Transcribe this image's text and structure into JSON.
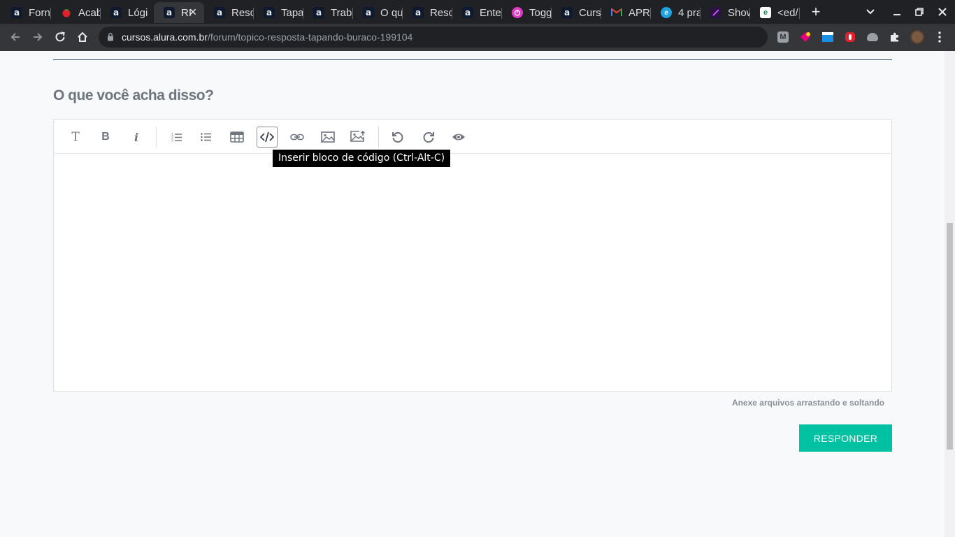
{
  "browser": {
    "tabs": [
      {
        "title": "Forn",
        "favicon": "alura-icon"
      },
      {
        "title": "Acab",
        "favicon": "tomato-icon"
      },
      {
        "title": "Lógi",
        "favicon": "alura-icon"
      },
      {
        "title": "RI",
        "favicon": "alura-icon",
        "active": true
      },
      {
        "title": "Reso",
        "favicon": "alura-icon"
      },
      {
        "title": "Tapa",
        "favicon": "alura-icon"
      },
      {
        "title": "Trab",
        "favicon": "alura-icon"
      },
      {
        "title": "O qu",
        "favicon": "alura-icon"
      },
      {
        "title": "Reso",
        "favicon": "alura-icon"
      },
      {
        "title": "Ente",
        "favicon": "alura-icon"
      },
      {
        "title": "Togg",
        "favicon": "toggl-icon"
      },
      {
        "title": "Curs",
        "favicon": "alura-icon"
      },
      {
        "title": "APR",
        "favicon": "gmail-icon"
      },
      {
        "title": "4 pra",
        "favicon": "blue-globe-icon"
      },
      {
        "title": "Show",
        "favicon": "purple-icon"
      },
      {
        "title": "<ed/",
        "favicon": "ed-icon"
      }
    ],
    "url_host": "cursos.alura.com.br",
    "url_path": "/forum/topico-resposta-tapando-buraco-199104",
    "colors": {
      "tabstrip": "#202124",
      "toolbar": "#35363a"
    }
  },
  "page": {
    "heading": "O que você acha disso?",
    "toolbar_tooltip": "Inserir bloco de código (Ctrl-Alt-C)",
    "attach_hint": "Anexe arquivos arrastando e soltando",
    "respond_button": "RESPONDER",
    "colors": {
      "accent": "#00c2a3",
      "heading": "#6f7580"
    },
    "editor_tools": [
      "heading-icon",
      "bold-icon",
      "italic-icon",
      "ordered-list-icon",
      "unordered-list-icon",
      "table-icon",
      "code-block-icon",
      "link-icon",
      "image-icon",
      "upload-image-icon",
      "undo-icon",
      "redo-icon",
      "preview-icon"
    ],
    "tool_glyphs": {
      "heading": "T",
      "bold": "B",
      "italic": "i"
    }
  }
}
